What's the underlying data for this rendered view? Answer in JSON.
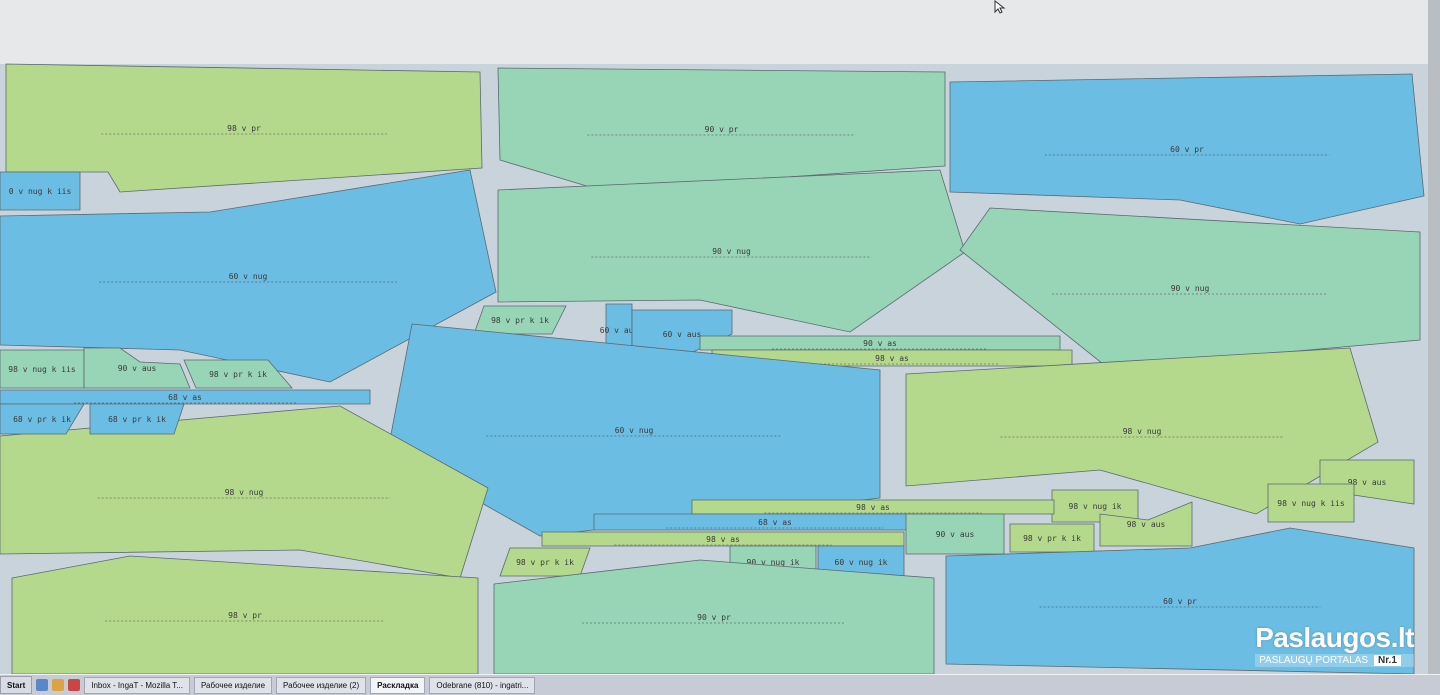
{
  "colors": {
    "green": "#b4d98c",
    "teal": "#98d4b6",
    "blue": "#6bbde3",
    "outline": "#5a6a70",
    "bg": "#c9d3db"
  },
  "pieces": [
    {
      "label": "98 v pr",
      "color": "green"
    },
    {
      "label": "90 v pr",
      "color": "teal"
    },
    {
      "label": "60 v pr",
      "color": "blue"
    },
    {
      "label": "0 v nug k iis",
      "color": "blue"
    },
    {
      "label": "60 v nug",
      "color": "blue"
    },
    {
      "label": "90 v nug",
      "color": "teal"
    },
    {
      "label": "90 v nug",
      "color": "teal"
    },
    {
      "label": "98 v pr k ik",
      "color": "teal"
    },
    {
      "label": "60 v aus",
      "color": "blue"
    },
    {
      "label": "60 v aus",
      "color": "blue"
    },
    {
      "label": "90 v as",
      "color": "teal"
    },
    {
      "label": "98 v as",
      "color": "green"
    },
    {
      "label": "98 v nug k iis",
      "color": "teal"
    },
    {
      "label": "90 v aus",
      "color": "teal"
    },
    {
      "label": "98 v pr k ik",
      "color": "teal"
    },
    {
      "label": "68 v as",
      "color": "blue"
    },
    {
      "label": "60 v nug",
      "color": "blue"
    },
    {
      "label": "98 v nug",
      "color": "green"
    },
    {
      "label": "68 v pr k ik",
      "color": "blue"
    },
    {
      "label": "68 v pr k ik",
      "color": "blue"
    },
    {
      "label": "98 v nug",
      "color": "green"
    },
    {
      "label": "98 v aus",
      "color": "green"
    },
    {
      "label": "98 v nug ik",
      "color": "green"
    },
    {
      "label": "98 v nug k iis",
      "color": "green"
    },
    {
      "label": "98 v as",
      "color": "green"
    },
    {
      "label": "68 v as",
      "color": "blue"
    },
    {
      "label": "98 v as",
      "color": "green"
    },
    {
      "label": "90 v aus",
      "color": "teal"
    },
    {
      "label": "98 v pr k ik",
      "color": "green"
    },
    {
      "label": "98 v aus",
      "color": "green"
    },
    {
      "label": "98 v pr k ik",
      "color": "green"
    },
    {
      "label": "90 v nug ik",
      "color": "teal"
    },
    {
      "label": "60 v nug ik",
      "color": "blue"
    },
    {
      "label": "98 v pr",
      "color": "green"
    },
    {
      "label": "90 v pr",
      "color": "teal"
    },
    {
      "label": "60 v pr",
      "color": "blue"
    }
  ],
  "taskbar": {
    "start": "Start",
    "windows": [
      {
        "label": "Inbox - IngaT - Mozilla T...",
        "active": false
      },
      {
        "label": "Рабочее изделие",
        "active": false
      },
      {
        "label": "Рабочее изделие (2)",
        "active": false
      },
      {
        "label": "Раскладка",
        "active": true
      },
      {
        "label": "Odebrane (810) - ingatri...",
        "active": false
      }
    ]
  },
  "watermark": {
    "title": "Paslaugos.lt",
    "subtitle": "PASLAUGŲ PORTALAS",
    "badge": "Nr.1"
  }
}
